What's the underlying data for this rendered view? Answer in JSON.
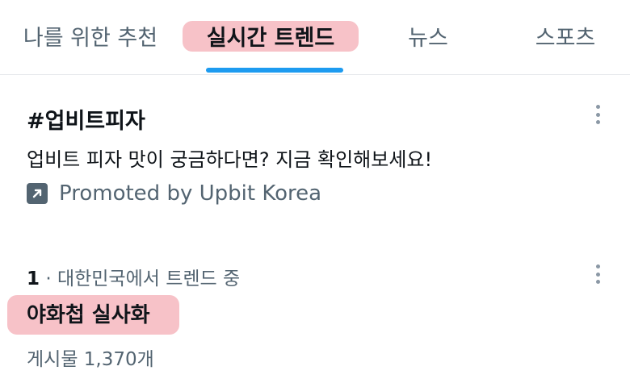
{
  "tabs": [
    {
      "label": "나를 위한 추천",
      "active": false
    },
    {
      "label": "실시간 트렌드",
      "active": true
    },
    {
      "label": "뉴스",
      "active": false
    },
    {
      "label": "스포츠",
      "active": false
    }
  ],
  "promoted_trend": {
    "title": "#업비트피자",
    "description": "업비트 피자 맛이 궁금하다면? 지금 확인해보세요!",
    "promoted_label": "Promoted by Upbit Korea"
  },
  "trend": {
    "rank": "1",
    "separator": " · ",
    "context": "대한민국에서 트렌드 중",
    "name": "야화첩 실사화",
    "post_count": "게시물 1,370개"
  },
  "colors": {
    "accent": "#1d9bf0",
    "highlight": "#f6b7be",
    "secondary_text": "#536471"
  }
}
